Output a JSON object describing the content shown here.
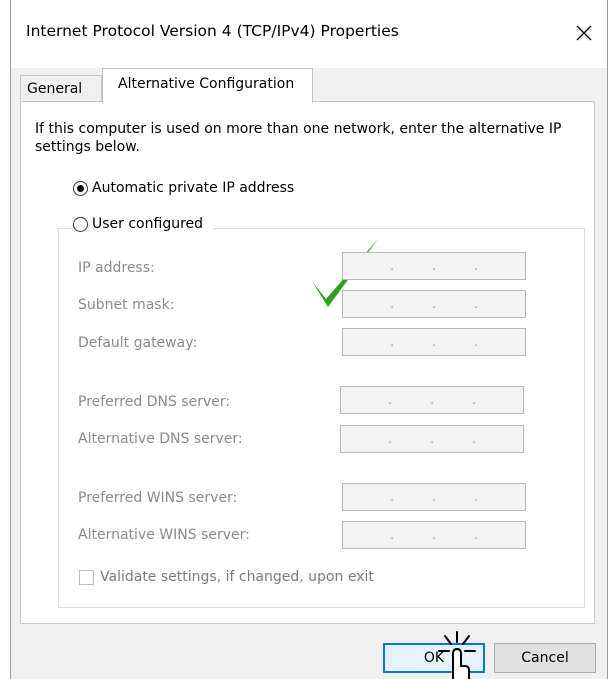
{
  "window": {
    "title": "Internet Protocol Version 4 (TCP/IPv4) Properties"
  },
  "tabs": [
    {
      "label": "General"
    },
    {
      "label": "Alternative Configuration"
    }
  ],
  "intro_text": "If this computer is used on more than one network, enter the alternative IP settings below.",
  "options": {
    "automatic": {
      "label": "Automatic private IP address",
      "selected": true
    },
    "user_configured": {
      "label": "User configured",
      "selected": false
    }
  },
  "fields": {
    "ip_address": {
      "label": "IP address:",
      "value": ". . ."
    },
    "subnet_mask": {
      "label": "Subnet mask:",
      "value": ". . ."
    },
    "default_gateway": {
      "label": "Default gateway:",
      "value": ". . ."
    },
    "preferred_dns": {
      "label": "Preferred DNS server:",
      "value": ". . ."
    },
    "alternative_dns": {
      "label": "Alternative DNS server:",
      "value": ". . ."
    },
    "preferred_wins": {
      "label": "Preferred WINS server:",
      "value": ". . ."
    },
    "alternative_wins": {
      "label": "Alternative WINS server:",
      "value": ". . ."
    }
  },
  "validate": {
    "label": "Validate settings, if changed, upon exit",
    "checked": false
  },
  "buttons": {
    "ok": "OK",
    "cancel": "Cancel"
  },
  "annotations": {
    "checkmark_color": "#2ea11f",
    "cursor_icon": "hand-pointer-click-icon"
  },
  "colors": {
    "accent": "#0078d7",
    "disabled_text": "#8a8a8a"
  }
}
